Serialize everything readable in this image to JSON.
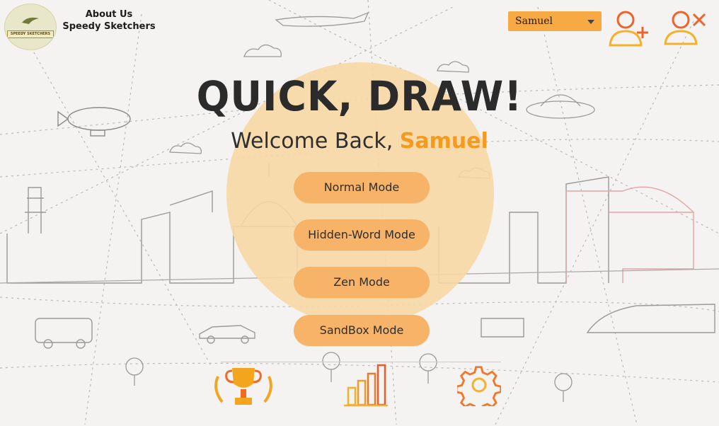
{
  "header": {
    "logo_text": "SPEEDY SKETCHERS",
    "about_line1": "About Us",
    "about_line2": "Speedy Sketchers",
    "user_select_value": "Samuel",
    "add_user_icon": "add-user-icon",
    "remove_user_icon": "remove-user-icon"
  },
  "main": {
    "title": "QUICK, DRAW!",
    "welcome_prefix": "Welcome Back, ",
    "welcome_name": "Samuel",
    "modes": [
      "Normal Mode",
      "Hidden-Word Mode",
      "Zen Mode",
      "SandBox Mode"
    ]
  },
  "footer": {
    "icons": [
      "trophy-icon",
      "leaderboard-icon",
      "settings-icon"
    ]
  },
  "colors": {
    "accent": "#f7a944",
    "button": "#f7b469",
    "sun": "#f7d8a4",
    "name": "#f59a1e"
  }
}
